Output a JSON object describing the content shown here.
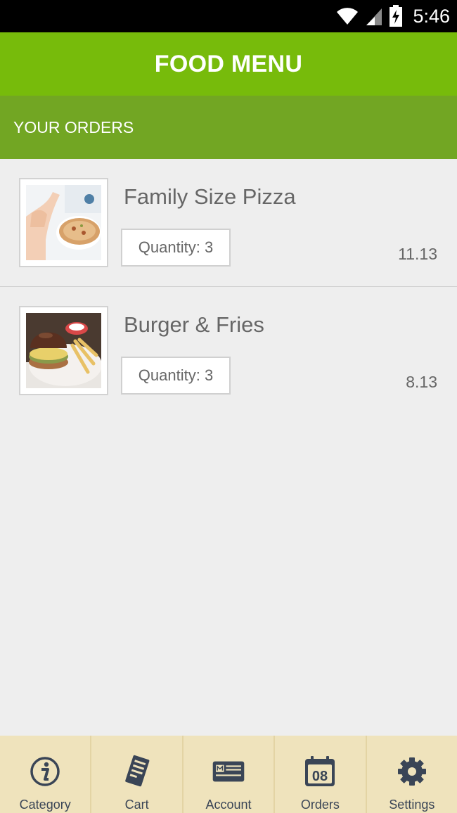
{
  "status_bar": {
    "time": "5:46",
    "icons": [
      "wifi-icon",
      "signal-icon",
      "battery-charging-icon"
    ]
  },
  "app_bar": {
    "title": "FOOD MENU"
  },
  "section": {
    "title": "YOUR ORDERS"
  },
  "orders": [
    {
      "name": "Family Size Pizza",
      "quantity_label": "Quantity: 3",
      "price": "11.13",
      "image": "pizza-photo"
    },
    {
      "name": "Burger & Fries",
      "quantity_label": "Quantity: 3",
      "price": "8.13",
      "image": "burger-photo"
    }
  ],
  "bottom_nav": {
    "items": [
      {
        "label": "Category",
        "icon": "info-icon"
      },
      {
        "label": "Cart",
        "icon": "receipt-icon"
      },
      {
        "label": "Account",
        "icon": "id-card-icon"
      },
      {
        "label": "Orders",
        "icon": "calendar-icon",
        "icon_text": "08"
      },
      {
        "label": "Settings",
        "icon": "gear-icon"
      }
    ]
  },
  "colors": {
    "app_bar": "#77bb0b",
    "section_header": "#72a623",
    "background": "#eeeeee",
    "bottom_nav": "#efe3bc",
    "nav_icon": "#3a4556",
    "text": "#666666"
  }
}
